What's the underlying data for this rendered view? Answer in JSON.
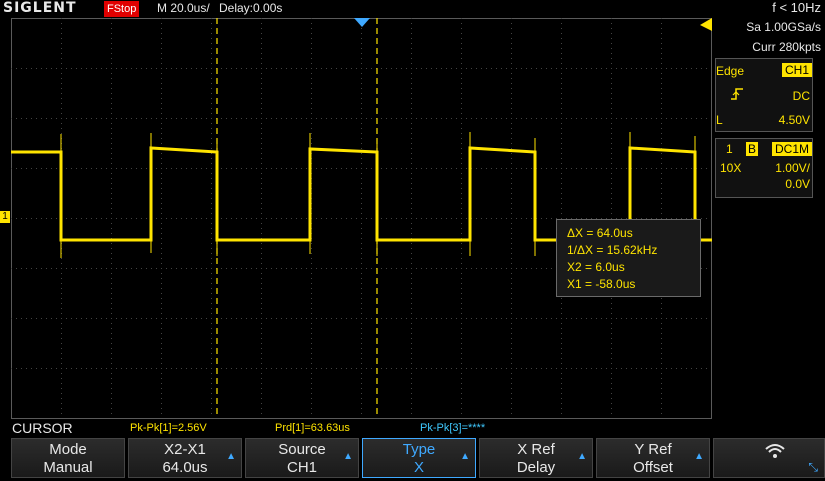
{
  "top": {
    "logo": "SIGLENT",
    "run_state": "FStop",
    "timebase": "M 20.0us/",
    "delay": "Delay:0.00s",
    "frequency": "f < 10Hz"
  },
  "right_panel": {
    "sample_rate": "Sa 1.00GSa/s",
    "curr_points": "Curr 280kpts",
    "trigger_type": "Edge",
    "trigger_source": "CH1",
    "trigger_slope_icon": "rising-edge-icon",
    "trigger_coupling": "DC",
    "trigger_level_label": "L",
    "trigger_level": "4.50V",
    "channel_number": "1",
    "bandwidth_badge": "B",
    "coupling": "DC1M",
    "probe": "10X",
    "vdiv": "1.00V/",
    "offset": "0.0V"
  },
  "channel_marker": "1",
  "cursor_readout": {
    "dx": "ΔX = 64.0us",
    "inv_dx": "1/ΔX = 15.62kHz",
    "x2": "X2 = 6.0us",
    "x1": "X1 = -58.0us"
  },
  "measurements": {
    "title": "CURSOR",
    "m1": "Pk-Pk[1]=2.56V",
    "m2": "Prd[1]=63.63us",
    "m3": "Pk-Pk[3]=****"
  },
  "softkeys": [
    {
      "line1": "Mode",
      "line2": "Manual"
    },
    {
      "line1": "X2-X1",
      "line2": "64.0us"
    },
    {
      "line1": "Source",
      "line2": "CH1"
    },
    {
      "line1": "Type",
      "line2": "X"
    },
    {
      "line1": "X Ref",
      "line2": "Delay"
    },
    {
      "line1": "Y Ref",
      "line2": "Offset"
    }
  ],
  "colors": {
    "trace": "#ffe400",
    "accent": "#3fa9ff",
    "run_state_bg": "#e00000"
  }
}
